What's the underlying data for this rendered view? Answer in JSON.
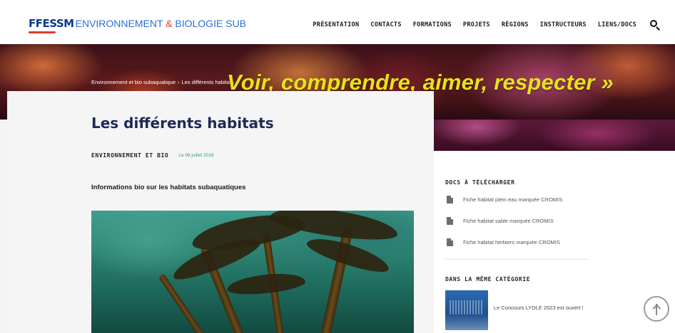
{
  "header": {
    "logo_brand": "FFESSM",
    "logo_tagline_1": "ENVIRONNEMENT",
    "logo_amp": "&",
    "logo_tagline_2": "BIOLOGIE SUB",
    "nav": [
      "PRÉSENTATION",
      "CONTACTS",
      "FORMATIONS",
      "PROJETS",
      "RÉGIONS",
      "INSTRUCTEURS",
      "LIENS/DOCS"
    ],
    "search_icon": "search-icon"
  },
  "banner": {
    "breadcrumb_1": "Environnement et bio subaquatique",
    "breadcrumb_sep": "›",
    "breadcrumb_2": "Les différents habitats",
    "slogan": "Voir, comprendre, aimer, respecter »"
  },
  "article": {
    "title": "Les différents habitats",
    "category": "ENVIRONNEMENT ET BIO",
    "date": "Le 09 juillet 2019",
    "subtitle": "Informations bio sur les habitats subaquatiques"
  },
  "sidebar": {
    "docs_heading": "DOCS À TÉLÉCHARGER",
    "docs": [
      "Fiche habitat plein eau marquée CROMIS",
      "Fiche habitat sable marquée CROMIS",
      "Fiche habitat herbiers marquée CROMIS"
    ],
    "related_heading": "DANS LA MÊME CATÉGORIE",
    "related_title": "Le Concours LYDLE 2023 est ouvert !"
  },
  "colors": {
    "slogan": "#e8e21a",
    "title": "#1d2a57",
    "date": "#2fa06f",
    "brand_blue": "#0a3a8c"
  }
}
